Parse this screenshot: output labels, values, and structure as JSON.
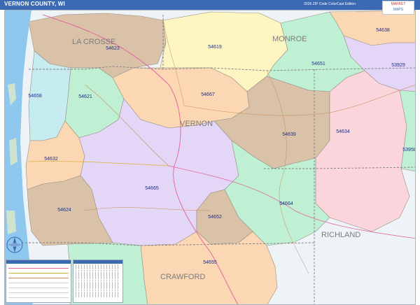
{
  "header": {
    "title": "VERNON COUNTY, WI",
    "edition": "2026 ZIP Code ColorCast Edition"
  },
  "logo": {
    "line1": "MARKET",
    "line2": "MAPS"
  },
  "map": {
    "water_color": "#8fc8ee",
    "counties": [
      {
        "name": "LA CROSSE"
      },
      {
        "name": "MONROE"
      },
      {
        "name": "VERNON"
      },
      {
        "name": "RICHLAND"
      },
      {
        "name": "CRAWFORD"
      }
    ],
    "zips": [
      {
        "code": "54623",
        "color": "#d9c2a8"
      },
      {
        "code": "54619",
        "color": "#fdf6c3"
      },
      {
        "code": "54638",
        "color": "#fbd7b3"
      },
      {
        "code": "53929",
        "color": "#e3d6f7"
      },
      {
        "code": "54651",
        "color": "#bff0d3"
      },
      {
        "code": "54658",
        "color": "#c6ecef"
      },
      {
        "code": "54621",
        "color": "#bff0d3"
      },
      {
        "code": "54667",
        "color": "#fbd7b3"
      },
      {
        "code": "54639",
        "color": "#d9c2a8"
      },
      {
        "code": "54634",
        "color": "#fbd5dc"
      },
      {
        "code": "53958",
        "color": "#bff0d3"
      },
      {
        "code": "54632",
        "color": "#fbd7b3"
      },
      {
        "code": "54665",
        "color": "#e3d6f7"
      },
      {
        "code": "54664",
        "color": "#bff0d3"
      },
      {
        "code": "54624",
        "color": "#d9c2a8"
      },
      {
        "code": "54652",
        "color": "#d9c2a8"
      },
      {
        "code": "54655",
        "color": "#fbd7b3"
      }
    ]
  }
}
